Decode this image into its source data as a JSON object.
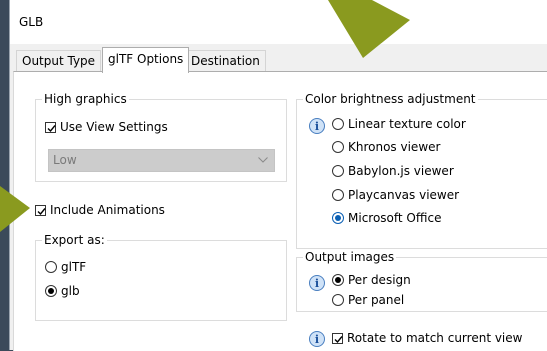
{
  "window": {
    "title": "GLB"
  },
  "tabs": [
    {
      "label": "Output Type",
      "active": false
    },
    {
      "label": "glTF Options",
      "active": true
    },
    {
      "label": "Destination",
      "active": false
    }
  ],
  "high_graphics": {
    "legend": "High graphics",
    "use_view_settings": {
      "label": "Use View Settings",
      "checked": true
    },
    "quality_select": {
      "value": "Low",
      "enabled": false
    }
  },
  "include_animations": {
    "label": "Include Animations",
    "checked": true
  },
  "export_as": {
    "legend": "Export as:",
    "options": [
      {
        "label": "glTF",
        "selected": false
      },
      {
        "label": "glb",
        "selected": true
      }
    ]
  },
  "color_brightness": {
    "legend": "Color brightness adjustment",
    "options": [
      {
        "label": "Linear texture color",
        "selected": false
      },
      {
        "label": "Khronos viewer",
        "selected": false
      },
      {
        "label": "Babylon.js viewer",
        "selected": false
      },
      {
        "label": "Playcanvas viewer",
        "selected": false
      },
      {
        "label": "Microsoft Office",
        "selected": true
      }
    ],
    "info_icon": "info-icon"
  },
  "output_images": {
    "legend": "Output images",
    "options": [
      {
        "label": "Per design",
        "selected": true
      },
      {
        "label": "Per panel",
        "selected": false
      }
    ],
    "info_icon": "info-icon"
  },
  "rotate_view": {
    "label": "Rotate to match current view",
    "checked": true,
    "info_icon": "info-icon"
  },
  "colors": {
    "accent": "#0a5fb4",
    "highlight_arrow": "#8a9a1f",
    "background": "#3b4a5a"
  }
}
